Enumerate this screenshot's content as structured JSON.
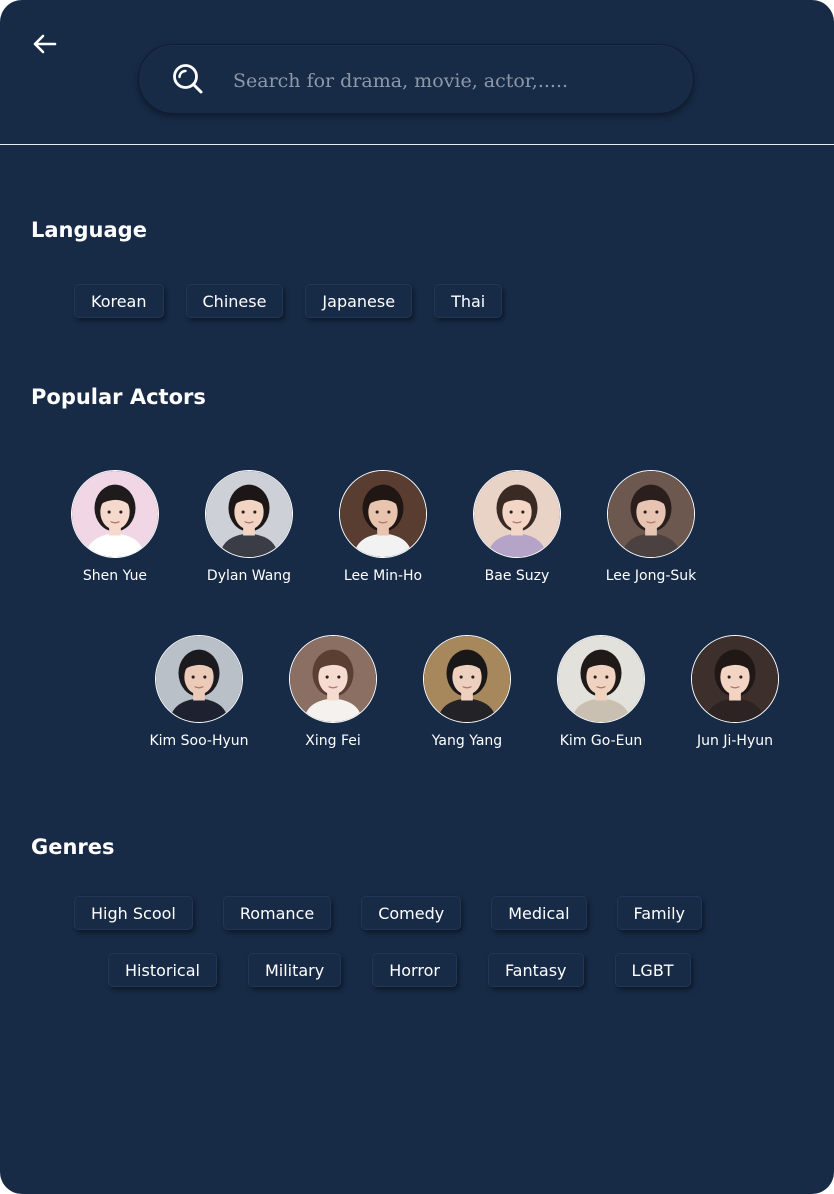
{
  "search": {
    "placeholder": "Search for drama, movie, actor,....."
  },
  "sections": {
    "language_title": "Language",
    "actors_title": "Popular Actors",
    "genres_title": "Genres"
  },
  "languages": [
    "Korean",
    "Chinese",
    "Japanese",
    "Thai"
  ],
  "actors": [
    {
      "name": "Shen Yue",
      "bg": "#f1d7e6",
      "hair": "#1f1a1c",
      "skin": "#f4d9cc",
      "cloth": "#ffffff"
    },
    {
      "name": "Dylan Wang",
      "bg": "#cdd0d6",
      "hair": "#1c1716",
      "skin": "#f1d4c3",
      "cloth": "#3a3d46"
    },
    {
      "name": "Lee Min-Ho",
      "bg": "#5a3d31",
      "hair": "#201715",
      "skin": "#e8c3ad",
      "cloth": "#f2f2f2"
    },
    {
      "name": "Bae Suzy",
      "bg": "#e9d2c6",
      "hair": "#3a2a24",
      "skin": "#f4d6c7",
      "cloth": "#b6a3c8"
    },
    {
      "name": "Lee Jong-Suk",
      "bg": "#6d5850",
      "hair": "#2a1f1c",
      "skin": "#e7c4b2",
      "cloth": "#4a4140"
    },
    {
      "name": "Kim Soo-Hyun",
      "bg": "#b9c0c8",
      "hair": "#1b1a1e",
      "skin": "#ebcbb8",
      "cloth": "#1e2230"
    },
    {
      "name": "Xing Fei",
      "bg": "#8c6f63",
      "hair": "#5b3f33",
      "skin": "#f6dbd0",
      "cloth": "#f5f1ee"
    },
    {
      "name": "Yang Yang",
      "bg": "#a7885d",
      "hair": "#1a1718",
      "skin": "#edd0bd",
      "cloth": "#222227"
    },
    {
      "name": "Kim Go-Eun",
      "bg": "#e3e1dc",
      "hair": "#1f1a18",
      "skin": "#f0d2c0",
      "cloth": "#c9c0b2"
    },
    {
      "name": "Jun Ji-Hyun",
      "bg": "#3d2f2c",
      "hair": "#201816",
      "skin": "#f2d4c4",
      "cloth": "#2c2322"
    }
  ],
  "genres": [
    "High Scool",
    "Romance",
    "Comedy",
    "Medical",
    "Family",
    "Historical",
    "Military",
    "Horror",
    "Fantasy",
    "LGBT"
  ],
  "colors": {
    "background": "#172a46",
    "text": "#ffffff",
    "divider": "#e8ecf2"
  },
  "icons": {
    "back": "arrow-left-icon",
    "search": "search-icon"
  }
}
